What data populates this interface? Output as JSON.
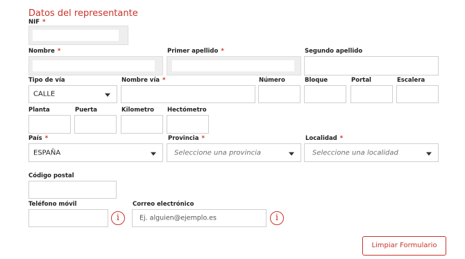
{
  "section_title": "Datos del representante",
  "fields": {
    "nif": {
      "label": "NIF",
      "required": "*"
    },
    "nombre": {
      "label": "Nombre",
      "required": "*"
    },
    "primer_apellido": {
      "label": "Primer apellido",
      "required": "*"
    },
    "segundo_apellido": {
      "label": "Segundo apellido"
    },
    "tipo_via": {
      "label": "Tipo de vía",
      "value": "CALLE"
    },
    "nombre_via": {
      "label": "Nombre vía",
      "required": "*"
    },
    "numero": {
      "label": "Número"
    },
    "bloque": {
      "label": "Bloque"
    },
    "portal": {
      "label": "Portal"
    },
    "escalera": {
      "label": "Escalera"
    },
    "planta": {
      "label": "Planta"
    },
    "puerta": {
      "label": "Puerta"
    },
    "kilometro": {
      "label": "Kilometro"
    },
    "hectometro": {
      "label": "Hectómetro"
    },
    "pais": {
      "label": "País",
      "required": "*",
      "value": "ESPAÑA"
    },
    "provincia": {
      "label": "Provincia",
      "required": "*",
      "placeholder": "Seleccione una provincia"
    },
    "localidad": {
      "label": "Localidad",
      "required": "*",
      "placeholder": "Seleccione una localidad"
    },
    "codigo_postal": {
      "label": "Código postal"
    },
    "telefono_movil": {
      "label": "Teléfono móvil"
    },
    "correo": {
      "label": "Correo electrónico",
      "placeholder": "Ej. alguien@ejemplo.es"
    }
  },
  "info_icon_glyph": "i",
  "buttons": {
    "clear": "Limpiar Formulario"
  },
  "colors": {
    "accent": "#c8332a",
    "disabled_bg": "#eeeeee",
    "border": "#cfcfcf"
  }
}
